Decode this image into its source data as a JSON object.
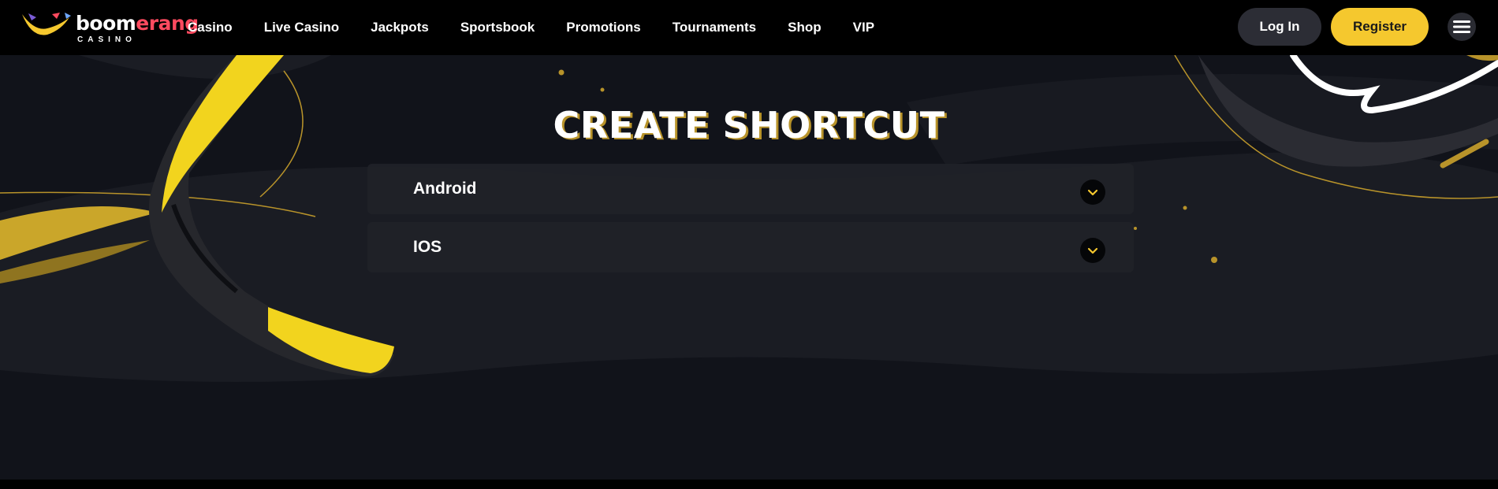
{
  "brand": {
    "name_part1": "boom",
    "name_part2": "erang",
    "sub": "CASINO"
  },
  "nav": {
    "items": [
      "Casino",
      "Live Casino",
      "Jackpots",
      "Sportsbook",
      "Promotions",
      "Tournaments",
      "Shop",
      "VIP"
    ]
  },
  "header": {
    "login_label": "Log In",
    "register_label": "Register"
  },
  "main": {
    "title": "CREATE SHORTCUT",
    "sections": [
      {
        "label": "Android",
        "icon": "chevron-down-icon"
      },
      {
        "label": "IOS",
        "icon": "chevron-down-icon"
      }
    ]
  },
  "colors": {
    "accent": "#f5c82e",
    "brand_red": "#ff4a5f",
    "background": "#11131a",
    "header": "#000000"
  }
}
